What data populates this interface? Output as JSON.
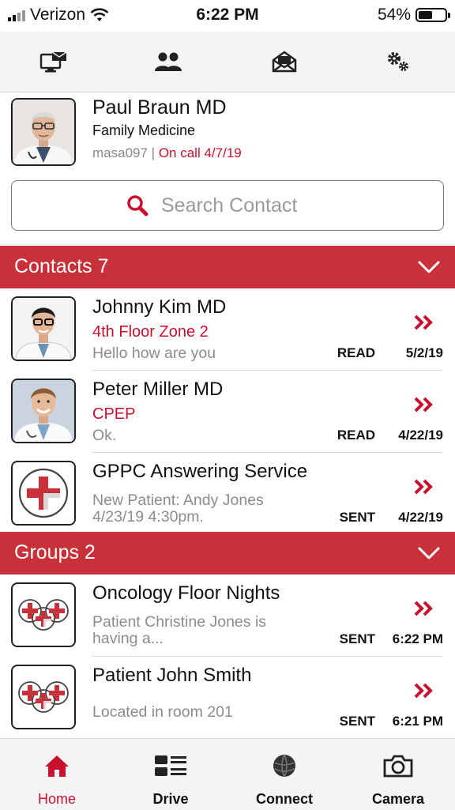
{
  "status_bar": {
    "carrier": "Verizon",
    "time": "6:22 PM",
    "battery": "54%",
    "battery_level": 0.54
  },
  "toolbar": {
    "icons": [
      "message-monitor-icon",
      "people-icon",
      "envelope-icon",
      "gears-icon"
    ]
  },
  "profile": {
    "name": "Paul Braun MD",
    "specialty": "Family Medicine",
    "username": "masa097",
    "separator": "|",
    "on_call": "On call 4/7/19"
  },
  "search": {
    "placeholder": "Search Contact"
  },
  "contacts": {
    "header": "Contacts 7",
    "items": [
      {
        "name": "Johnny Kim MD",
        "location": "4th Floor Zone 2",
        "message": "Hello how are you",
        "status": "READ",
        "date": "5/2/19"
      },
      {
        "name": "Peter Miller MD",
        "location": "CPEP",
        "message": "Ok.",
        "status": "READ",
        "date": "4/22/19"
      },
      {
        "name": "GPPC Answering Service",
        "message_line1": "New Patient: Andy Jones",
        "message_line2": "4/23/19 4:30pm.",
        "status": "SENT",
        "date": "4/22/19"
      }
    ]
  },
  "groups": {
    "header": "Groups 2",
    "items": [
      {
        "name": "Oncology Floor Nights",
        "message_line1": "Patient Christine Jones is",
        "message_line2": "having a...",
        "status": "SENT",
        "date": "6:22 PM"
      },
      {
        "name": "Patient John Smith",
        "message": "Located in room 201",
        "status": "SENT",
        "date": "6:21 PM"
      }
    ]
  },
  "tabbar": {
    "home": "Home",
    "drive": "Drive",
    "connect": "Connect",
    "camera": "Camera",
    "active": "Home"
  },
  "colors": {
    "accent": "#c8102e",
    "section_bg": "#c8303a",
    "toolbar_bg": "#f4f4f4"
  }
}
